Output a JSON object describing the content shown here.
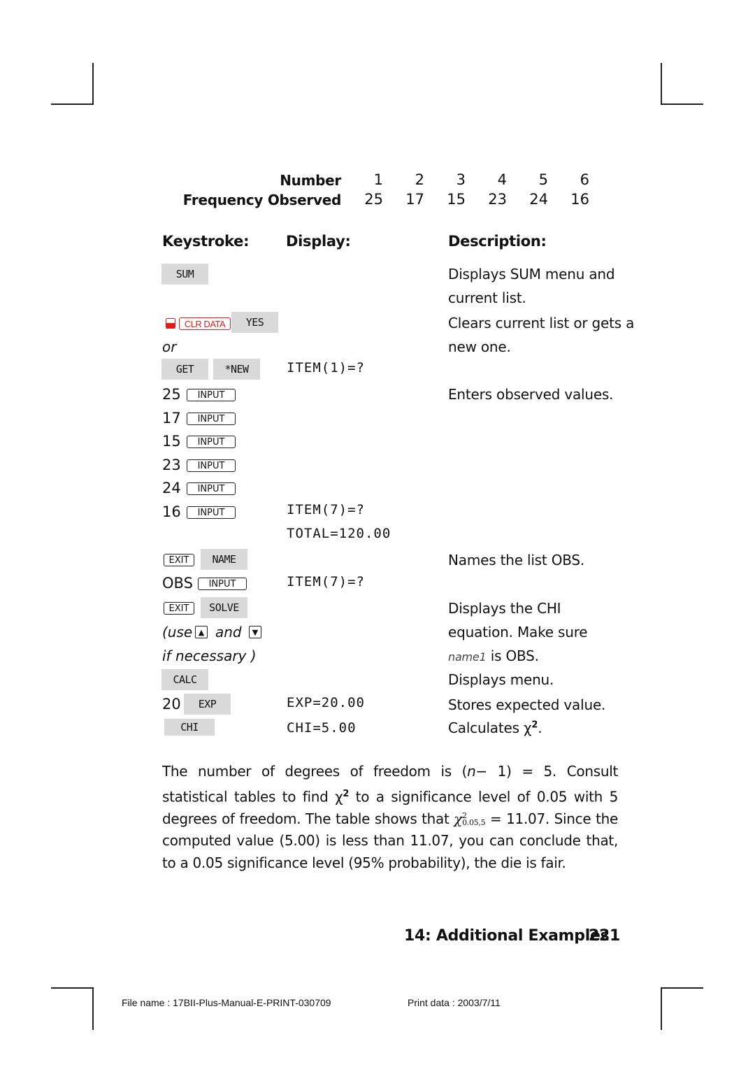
{
  "frequency_table": {
    "row_labels": [
      "Number",
      "Frequency Observed"
    ],
    "numbers": [
      "1",
      "2",
      "3",
      "4",
      "5",
      "6"
    ],
    "observed": [
      "25",
      "17",
      "15",
      "23",
      "24",
      "16"
    ]
  },
  "headers": {
    "keystroke": "Keystroke:",
    "display": "Display:",
    "description": "Description:"
  },
  "keys": {
    "sum": "SUM",
    "clr_data": "CLR DATA",
    "yes": "YES",
    "or": "or",
    "get": "GET",
    "new": "*NEW",
    "input": "INPUT",
    "exit": "EXIT",
    "name": "NAME",
    "solve": "SOLVE",
    "calc": "CALC",
    "exp": "EXP",
    "chi": "CHI",
    "up_arrow": "▲",
    "down_arrow": "▼"
  },
  "steps": {
    "entries": [
      "25",
      "17",
      "15",
      "23",
      "24",
      "16"
    ],
    "obs": "OBS",
    "exp_value": "20",
    "use_prefix": "(use",
    "and": "and",
    "if_necessary": "if necessary )"
  },
  "displays": {
    "item1": "ITEM(1)=?",
    "item7": "ITEM(7)=?",
    "total": "TOTAL=120.00",
    "item7b": "ITEM(7)=?",
    "exp": "EXP=20.00",
    "chi": "CHI=5.00"
  },
  "descriptions": {
    "sum_1": "Displays SUM menu and",
    "sum_2": "current list.",
    "clear_1": "Clears current list or gets a",
    "clear_2": "new one.",
    "enters": "Enters observed values.",
    "names": "Names the list OBS.",
    "chi_1": "Displays the CHI",
    "chi_2": "equation. Make sure",
    "chi_3_var": "name1",
    "chi_3_rest": " is OBS.",
    "menu": "Displays menu.",
    "stores": "Stores expected value.",
    "calc_prefix": "Calculates χ",
    "calc_sup": "2",
    "calc_suffix": "."
  },
  "paragraph": {
    "p1": "The number of degrees of freedom is (",
    "p1_n": "n",
    "p1_b": "− 1) = 5. Consult statistical tables to find χ",
    "p1_sup": "2",
    "p1_c": " to a significance level of 0.05 with 5 degrees of freedom. The table shows that ",
    "chi_sym": "χ",
    "chi_sup": "2",
    "chi_sub": "0.05,5",
    "p1_d": " = 11.07. Since the computed value (5.00) is less than 11.07, you can conclude that, to a 0.05 significance level (95% probability), the die is fair."
  },
  "footer": {
    "chapter": "14: Additional Examples",
    "page": "221",
    "file_name": "File name : 17BII-Plus-Manual-E-PRINT-030709",
    "print_date": "Print data : 2003/7/11"
  }
}
